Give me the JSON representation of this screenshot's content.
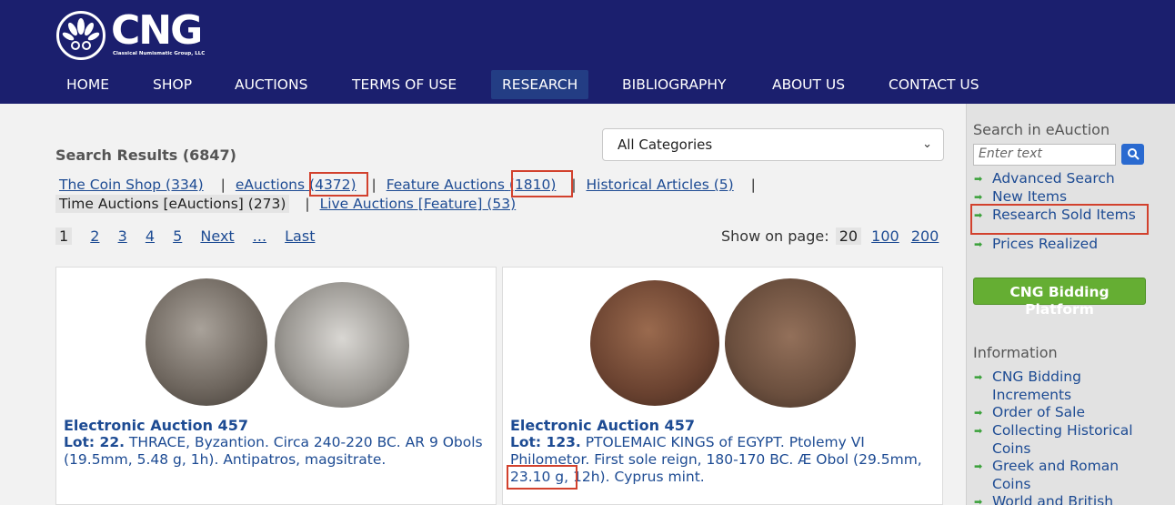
{
  "header": {
    "logo_text": "CNG",
    "logo_sub": "Classical Numismatic Group, LLC",
    "nav": [
      {
        "label": "HOME"
      },
      {
        "label": "SHOP"
      },
      {
        "label": "AUCTIONS"
      },
      {
        "label": "TERMS OF USE"
      },
      {
        "label": "RESEARCH"
      },
      {
        "label": "BIBLIOGRAPHY"
      },
      {
        "label": "ABOUT US"
      },
      {
        "label": "CONTACT US"
      }
    ],
    "active_nav": "RESEARCH"
  },
  "main": {
    "results_title": "Search Results (6847)",
    "category_select": "All Categories",
    "sources": [
      {
        "label": "The Coin Shop (334)"
      },
      {
        "label": "eAuctions",
        "count": "(4372)"
      },
      {
        "label": "Feature Auctions",
        "count": "(1810)"
      },
      {
        "label": "Historical Articles (5)"
      },
      {
        "label": "Time Auctions [eAuctions] (273)"
      },
      {
        "label": "Live Auctions [Feature] (53)"
      }
    ],
    "separator": "|",
    "pager": {
      "current": "1",
      "pages": [
        "2",
        "3",
        "4",
        "5"
      ],
      "next": "Next",
      "ellipsis": "...",
      "last": "Last"
    },
    "per_page": {
      "label": "Show on page:",
      "current": "20",
      "options": [
        "100",
        "200"
      ]
    },
    "cards": [
      {
        "auction": "Electronic Auction 457",
        "lot_label": "Lot: 22.",
        "desc": " THRACE, Byzantion. Circa 240-220 BC. AR 9 Obols (19.5mm, 5.48 g, 1h). Antipatros, magsitrate."
      },
      {
        "auction": "Electronic Auction 457",
        "lot_label": "Lot: 123.",
        "desc": " PTOLEMAIC KINGS of EGYPT. Ptolemy VI Philometor. First sole reign, 180-170 BC. Æ Obol (29.5mm, 23.10 g, 12h). Cyprus mint."
      }
    ]
  },
  "sidebar": {
    "search_heading": "Search in eAuction",
    "search_placeholder": "Enter text",
    "links": [
      {
        "label": "Advanced Search"
      },
      {
        "label": "New Items"
      },
      {
        "label": "Research Sold Items"
      },
      {
        "label": "Prices Realized"
      }
    ],
    "bidding_button": "CNG Bidding Platform",
    "info_heading": "Information",
    "info_links": [
      {
        "label": "CNG Bidding Increments"
      },
      {
        "label": "Order of Sale"
      },
      {
        "label": "Collecting Historical Coins"
      },
      {
        "label": "Greek and Roman Coins"
      },
      {
        "label": "World and British"
      }
    ]
  },
  "colors": {
    "header_bg": "#1b1f6e",
    "nav_active": "#233d84",
    "link": "#1d4b93",
    "highlight_box": "#d2412d",
    "bidding_button": "#65ae33"
  }
}
